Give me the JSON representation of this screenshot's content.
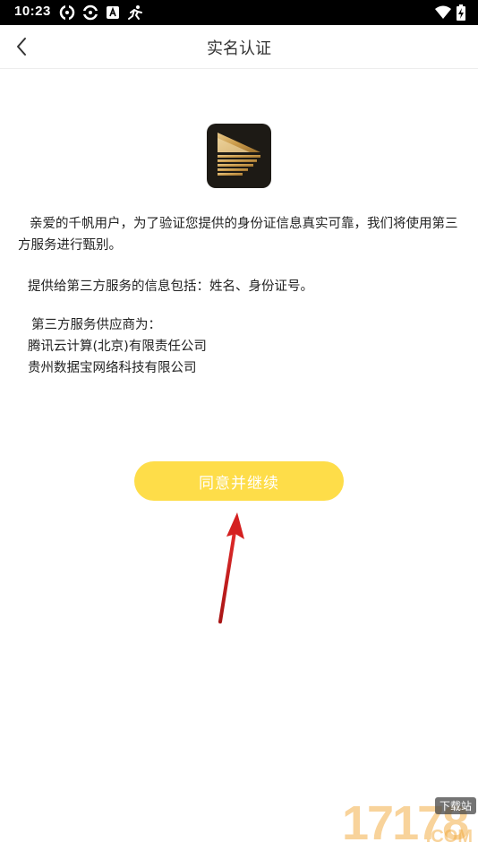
{
  "status_bar": {
    "time": "10:23"
  },
  "header": {
    "title": "实名认证"
  },
  "content": {
    "intro": "亲爱的千帆用户，为了验证您提供的身份证信息真实可靠，我们将使用第三方服务进行甄别。",
    "info": "提供给第三方服务的信息包括：姓名、身份证号。",
    "providers_heading": "第三方服务供应商为：",
    "providers": [
      "腾讯云计算(北京)有限责任公司",
      "贵州数据宝网络科技有限公司"
    ]
  },
  "actions": {
    "agree_label": "同意并继续"
  },
  "colors": {
    "button": "#fedd49",
    "arrow": "#d42020"
  },
  "watermark": {
    "digits": "17178",
    "badge": "下载站",
    "sub": ".COM"
  }
}
